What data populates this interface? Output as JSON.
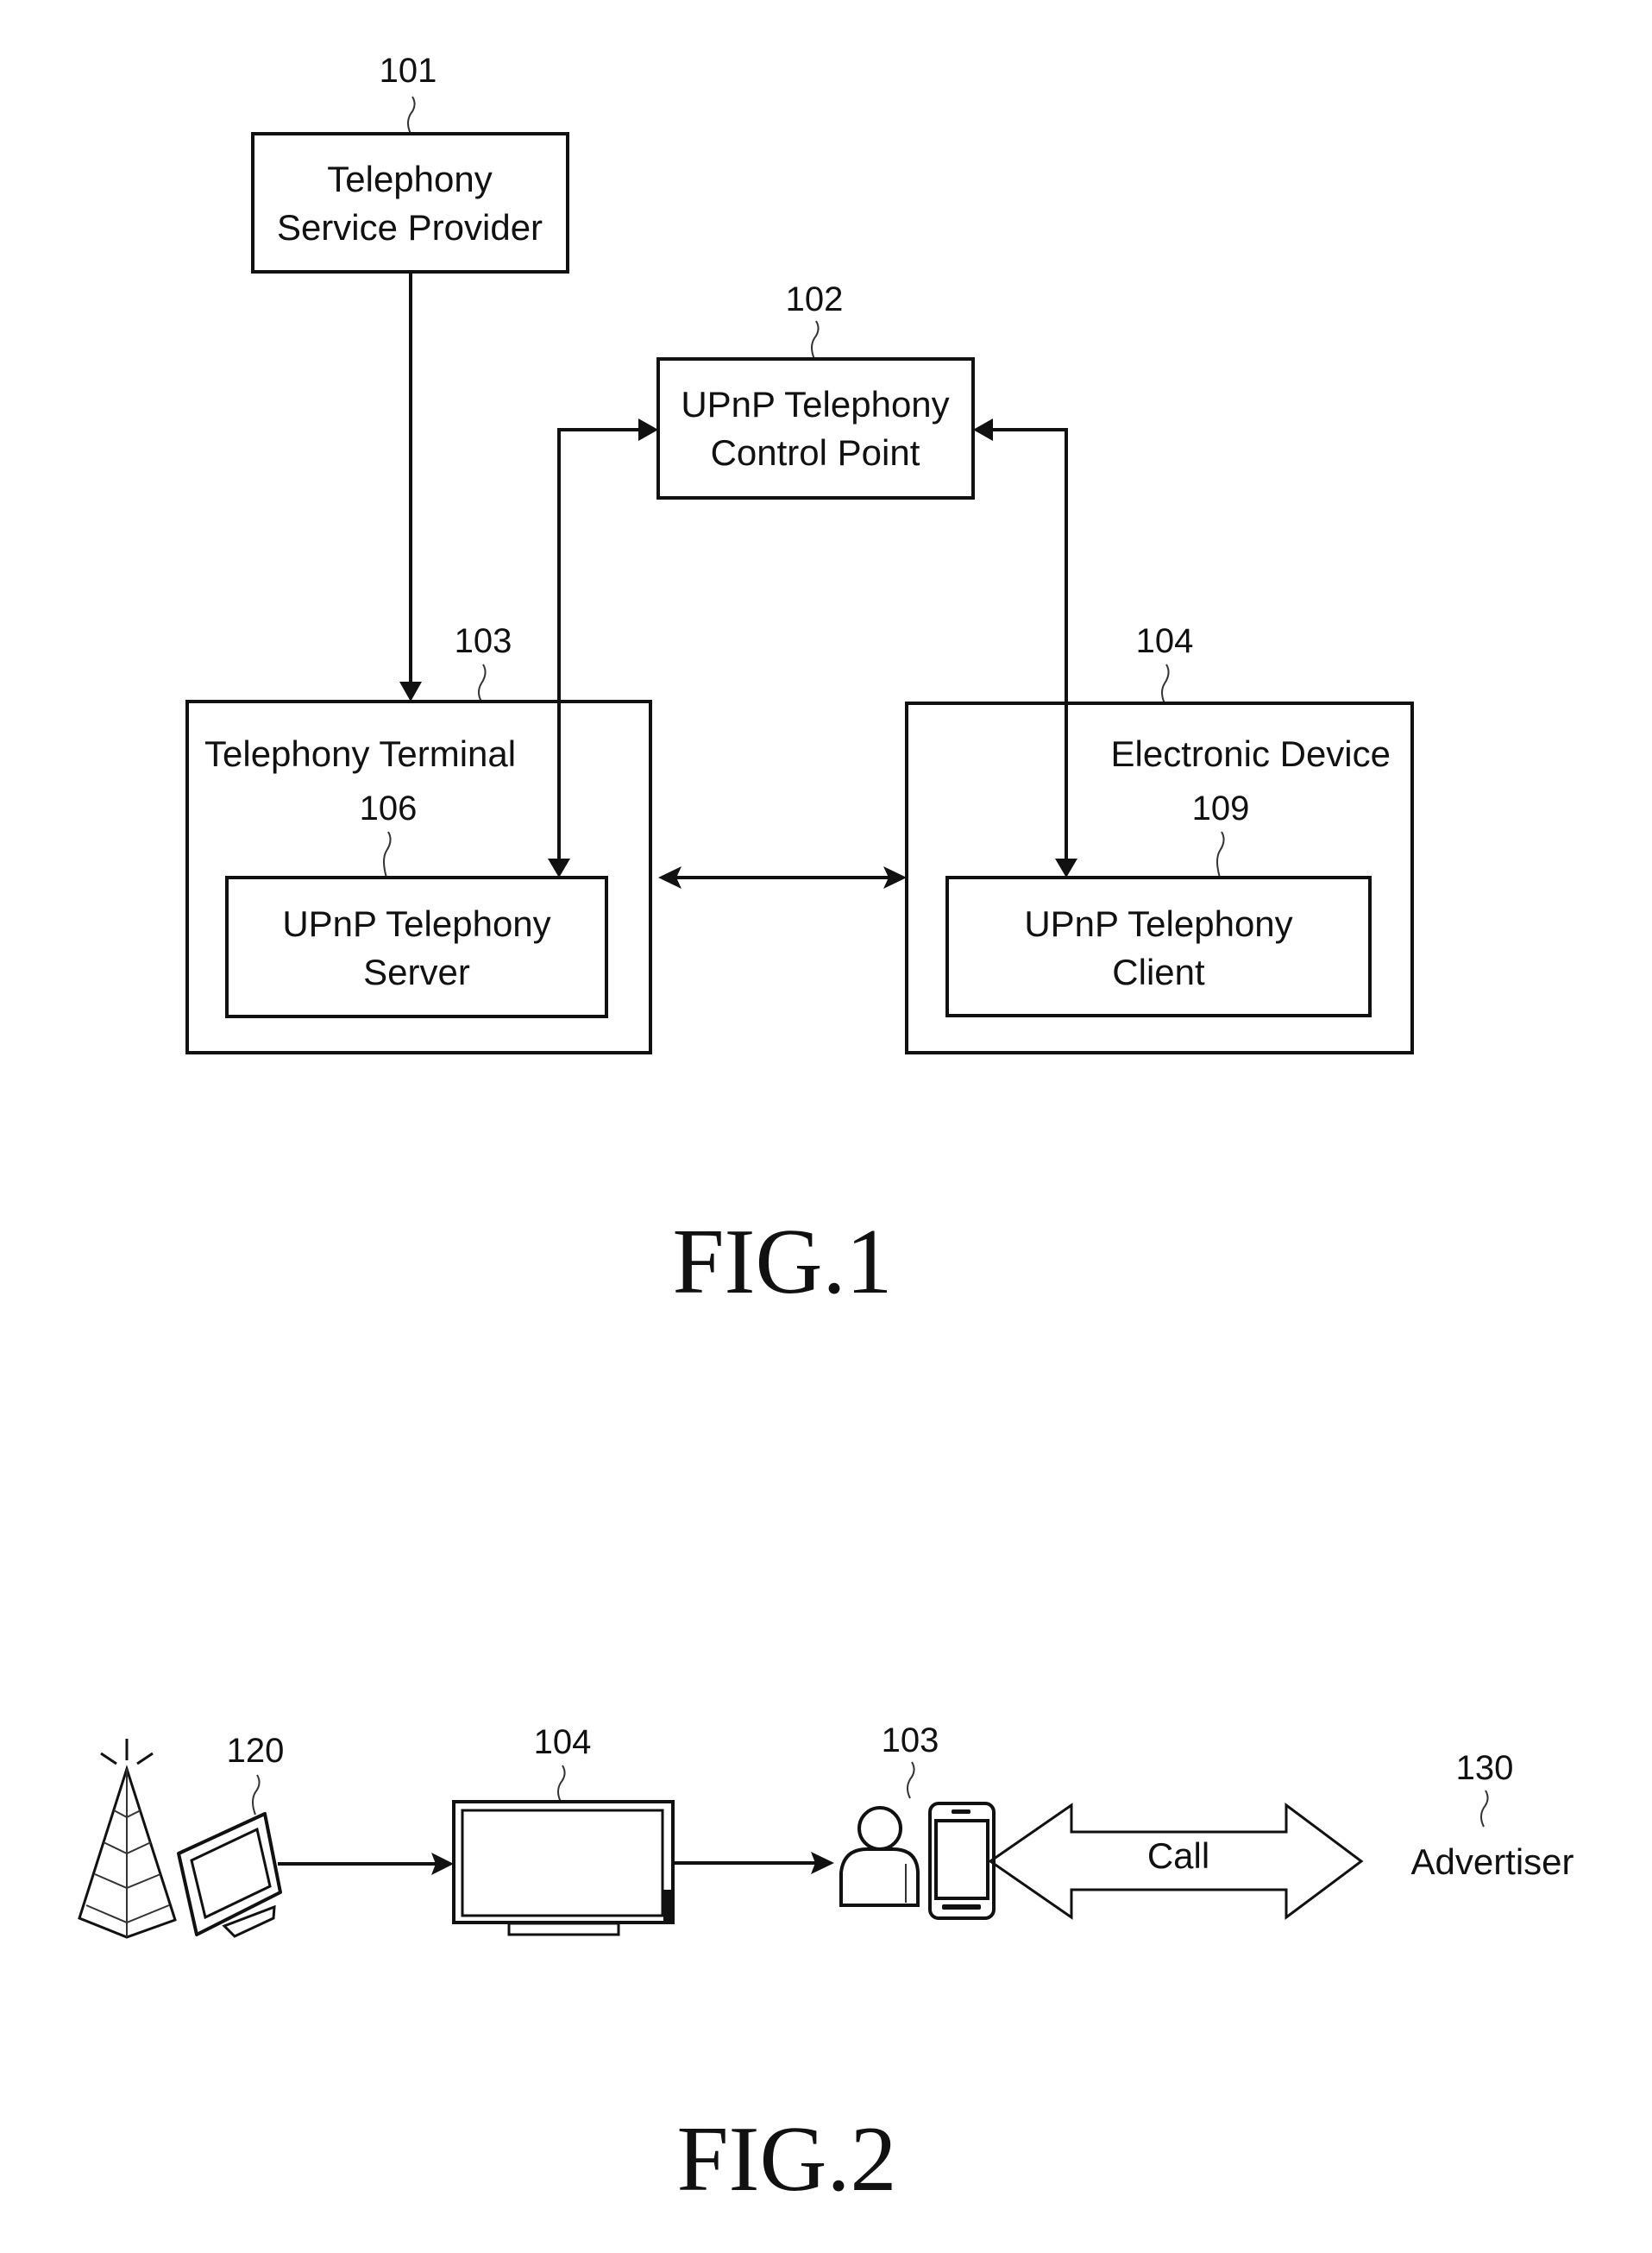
{
  "figures": [
    {
      "caption": "FIG.1",
      "nodes": {
        "telephony_service_provider": {
          "ref": "101",
          "lines": [
            "Telephony",
            "Service Provider"
          ]
        },
        "control_point": {
          "ref": "102",
          "lines": [
            "UPnP Telephony",
            "Control Point"
          ]
        },
        "telephony_terminal": {
          "ref": "103",
          "title": "Telephony Terminal"
        },
        "telephony_server": {
          "ref": "106",
          "lines": [
            "UPnP Telephony",
            "Server"
          ]
        },
        "electronic_device": {
          "ref": "104",
          "title": "Electronic Device"
        },
        "telephony_client": {
          "ref": "109",
          "lines": [
            "UPnP Telephony",
            "Client"
          ]
        }
      },
      "edges": [
        {
          "from": "101",
          "to": "103",
          "direction": "one-way"
        },
        {
          "from": "102",
          "to": "106",
          "direction": "two-way"
        },
        {
          "from": "102",
          "to": "109",
          "direction": "two-way"
        },
        {
          "from": "103",
          "to": "104",
          "direction": "two-way"
        }
      ]
    },
    {
      "caption": "FIG.2",
      "nodes": {
        "broadcast_source": {
          "ref": "120",
          "icons": [
            "broadcast-tower-icon",
            "monitor-icon"
          ]
        },
        "electronic_device": {
          "ref": "104",
          "icons": [
            "tv-icon"
          ]
        },
        "telephony_terminal": {
          "ref": "103",
          "icons": [
            "user-icon",
            "smartphone-icon"
          ]
        },
        "advertiser": {
          "ref": "130",
          "label": "Advertiser"
        }
      },
      "call_label": "Call",
      "edges": [
        {
          "from": "120",
          "to": "104",
          "direction": "one-way"
        },
        {
          "from": "104",
          "to": "103",
          "direction": "one-way"
        },
        {
          "from": "103",
          "to": "130",
          "direction": "two-way",
          "label": "Call"
        }
      ]
    }
  ]
}
